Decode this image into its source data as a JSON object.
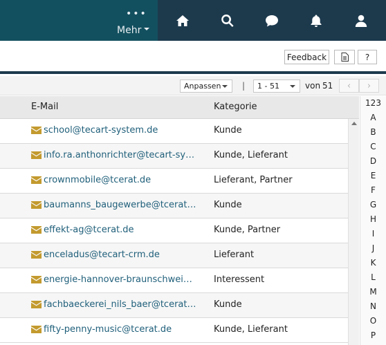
{
  "nav": {
    "dots": "•••",
    "more_label": "Mehr",
    "icons": [
      "home-icon",
      "search-icon",
      "chat-icon",
      "bell-icon",
      "user-icon"
    ]
  },
  "toolbar": {
    "feedback_label": "Feedback",
    "help_label": "?"
  },
  "pager": {
    "adjust_label": "Anpassen",
    "separator": "|",
    "range_value": "1 - 51",
    "von_label": "von",
    "total": "51",
    "prev": "‹",
    "next": "›"
  },
  "table": {
    "columns": [
      "E-Mail",
      "Kategorie"
    ],
    "rows": [
      {
        "email": "school@tecart-system.de",
        "kategorie": "Kunde"
      },
      {
        "email": "info.ra.anthonrichter@tecart-system.de",
        "kategorie": "Kunde, Lieferant"
      },
      {
        "email": "crownmobile@tcerat.de",
        "kategorie": "Lieferant, Partner"
      },
      {
        "email": "baumanns_baugewerbe@tcerat.de",
        "kategorie": "Kunde"
      },
      {
        "email": "effekt-ag@tcerat.de",
        "kategorie": "Kunde, Partner"
      },
      {
        "email": "enceladus@tecart-crm.de",
        "kategorie": "Lieferant"
      },
      {
        "email": "energie-hannover-braunschweig@tcerat.de",
        "kategorie": "Interessent"
      },
      {
        "email": "fachbaeckerei_nils_baer@tcerat.de",
        "kategorie": "Kunde"
      },
      {
        "email": "fifty-penny-music@tcerat.de",
        "kategorie": "Kunde, Lieferant"
      }
    ]
  },
  "alphabet": [
    "123",
    "A",
    "B",
    "C",
    "D",
    "E",
    "F",
    "G",
    "H",
    "I",
    "J",
    "K",
    "L",
    "M",
    "N",
    "O",
    "P"
  ],
  "colors": {
    "nav_left": "#13505f",
    "nav_right": "#1d3a4d",
    "mail_icon": "#c39a2e",
    "link": "#1f5f7a"
  }
}
